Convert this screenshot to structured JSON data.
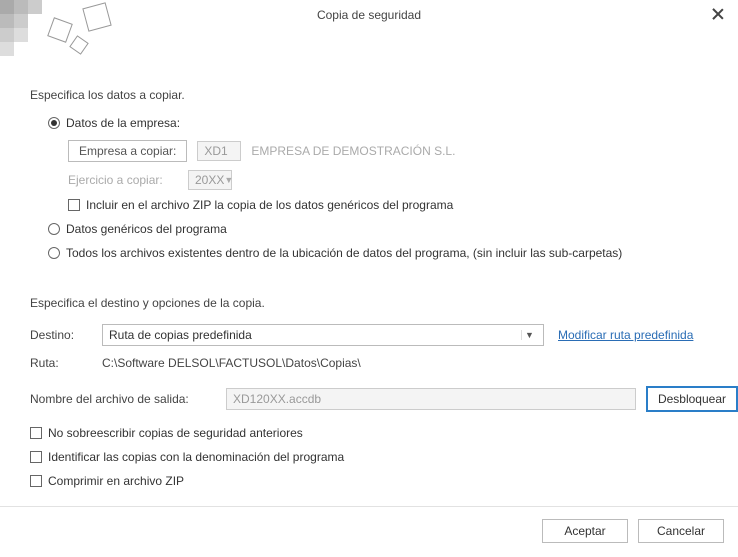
{
  "title": "Copia de seguridad",
  "section1": {
    "heading": "Especifica los datos a copiar.",
    "opt_company": "Datos de la empresa:",
    "btn_company": "Empresa a copiar:",
    "company_code": "XD1",
    "company_name": "EMPRESA DE DEMOSTRACIÓN S.L.",
    "lbl_year": "Ejercicio a copiar:",
    "year_value": "20XX",
    "chk_include_zip": "Incluir en el archivo ZIP la copia de los datos genéricos del programa",
    "opt_generic": "Datos genéricos del programa",
    "opt_all": "Todos los archivos existentes dentro de la ubicación de datos del programa, (sin incluir las sub-carpetas)"
  },
  "section2": {
    "heading": "Especifica el destino y opciones de la copia.",
    "lbl_dest": "Destino:",
    "combo_value": "Ruta de copias predefinida",
    "link_modify": "Modificar ruta predefinida",
    "lbl_path": "Ruta:",
    "path_value": "C:\\Software DELSOL\\FACTUSOL\\Datos\\Copias\\",
    "lbl_output": "Nombre del archivo de salida:",
    "output_value": "XD120XX.accdb",
    "btn_unlock": "Desbloquear",
    "chk_no_overwrite": "No sobreescribir copias de seguridad anteriores",
    "chk_identify": "Identificar las copias con la denominación del programa",
    "chk_compress": "Comprimir en archivo ZIP"
  },
  "footer": {
    "accept": "Aceptar",
    "cancel": "Cancelar"
  }
}
